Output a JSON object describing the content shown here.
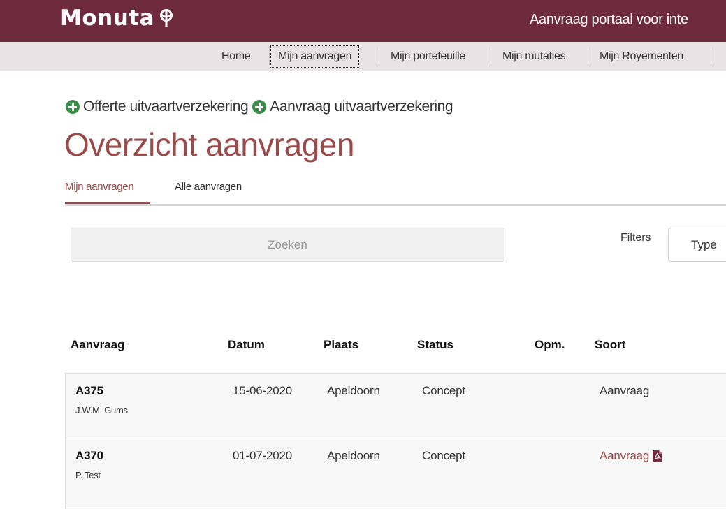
{
  "header": {
    "logo_text": "Monuta",
    "portal_title": "Aanvraag portaal voor inte"
  },
  "nav": {
    "items": [
      {
        "label": "Home"
      },
      {
        "label": "Mijn aanvragen"
      },
      {
        "label": "Mijn portefeuille"
      },
      {
        "label": "Mijn mutaties"
      },
      {
        "label": "Mijn Royementen"
      }
    ],
    "active": "Mijn aanvragen"
  },
  "actions": {
    "offerte_label": "Offerte uitvaartverzekering",
    "aanvraag_label": "Aanvraag uitvaartverzekering"
  },
  "page": {
    "title": "Overzicht aanvragen"
  },
  "tabs": [
    {
      "label": "Mijn aanvragen"
    },
    {
      "label": "Alle aanvragen"
    }
  ],
  "search": {
    "placeholder": "Zoeken"
  },
  "filters": {
    "label": "Filters",
    "type_select_value": "Type"
  },
  "table": {
    "headers": [
      "Aanvraag",
      "Datum",
      "Plaats",
      "Status",
      "Opm.",
      "Soort"
    ],
    "rows": [
      {
        "id": "A375",
        "name": "J.W.M. Gums",
        "datum": "15-06-2020",
        "plaats": "Apeldoorn",
        "status": "Concept",
        "opm": "",
        "soort": "Aanvraag"
      },
      {
        "id": "A370",
        "name": "P. Test",
        "datum": "01-07-2020",
        "plaats": "Apeldoorn",
        "status": "Concept",
        "opm": "",
        "soort": "Aanvraag"
      }
    ]
  },
  "colors": {
    "brand": "#6e2b3e",
    "accent": "#9a4a48",
    "plus_green": "#3a8f4a"
  }
}
